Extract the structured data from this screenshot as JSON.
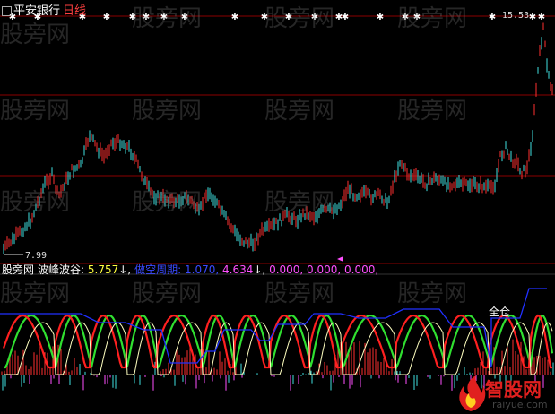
{
  "chart_header": {
    "stock_name": "平安银行",
    "period": "日线"
  },
  "price_panel": {
    "high_label": "15.53",
    "low_label": "7.99"
  },
  "indicator_panel": {
    "name": "股旁网",
    "label1": "波峰波谷:",
    "value1": "5.757",
    "arrow1": "↓,",
    "label2": "做空周期:",
    "value2": "1.070,",
    "value3": "4.634",
    "arrow2": "↓,",
    "tail": "0.000, 0.000, 0.000,",
    "signal_label": "全仓"
  },
  "watermarks": [
    "股旁网",
    "股旁网",
    "股旁网",
    "股旁网",
    "股旁网",
    "股旁网",
    "股旁网",
    "股旁网",
    "股旁网",
    "股旁网",
    "股旁网",
    "股旁网",
    "股旁网",
    "股旁网",
    "股旁网"
  ],
  "logo": {
    "brand": "智股网",
    "domain": "raiyue.com"
  },
  "colors": {
    "background": "#000000",
    "up_candle": "#ff3030",
    "down_candle": "#40e0e0",
    "grid": "#8b0000",
    "fast_line": "#ff2020",
    "slow_line": "#30e030",
    "ma_line": "#ffffc0",
    "envelope": "#2030ff"
  }
}
